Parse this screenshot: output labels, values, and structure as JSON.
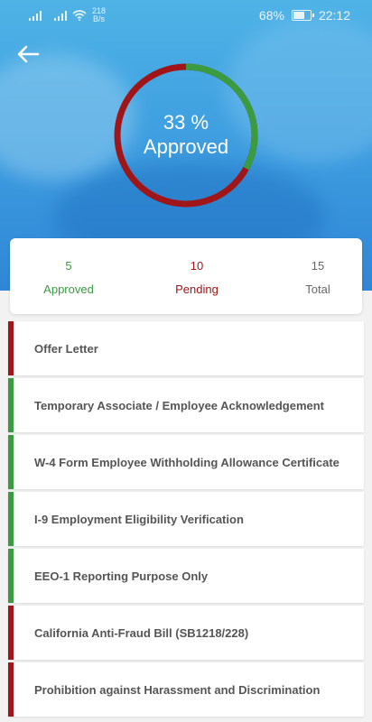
{
  "status_bar": {
    "net_speed_value": "218",
    "net_speed_unit": "B/s",
    "battery": "68%",
    "battery_level": 0.68,
    "time": "22:12"
  },
  "colors": {
    "approved": "#3a9b3f",
    "pending": "#a01518",
    "header_blue": "#3f9fe0"
  },
  "progress": {
    "percent_text": "33 %",
    "label": "Approved",
    "fraction": 0.33
  },
  "stats": {
    "approved": {
      "value": "5",
      "label": "Approved"
    },
    "pending": {
      "value": "10",
      "label": "Pending"
    },
    "total": {
      "value": "15",
      "label": "Total"
    }
  },
  "documents": [
    {
      "title": "Offer Letter",
      "status": "pending"
    },
    {
      "title": "Temporary Associate / Employee Acknowledgement",
      "status": "approved"
    },
    {
      "title": "W-4 Form Employee Withholding Allowance Certificate",
      "status": "approved"
    },
    {
      "title": "I-9 Employment Eligibility Verification",
      "status": "approved"
    },
    {
      "title": "EEO-1 Reporting Purpose Only",
      "status": "approved"
    },
    {
      "title": "California Anti-Fraud Bill (SB1218/228)",
      "status": "pending"
    },
    {
      "title": "Prohibition against Harassment and Discrimination",
      "status": "pending"
    }
  ]
}
